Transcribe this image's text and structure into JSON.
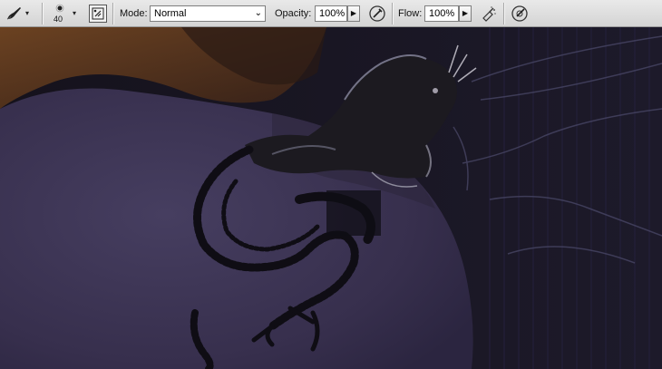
{
  "toolbar": {
    "brush_size": "40",
    "mode_label": "Mode:",
    "mode_value": "Normal",
    "opacity_label": "Opacity:",
    "opacity_value": "100%",
    "flow_label": "Flow:",
    "flow_value": "100%",
    "arrow_glyph": "▶",
    "dropdown_glyph": "▾"
  },
  "icons": {
    "brush_tool": "brush-icon",
    "brush_preset": "brush-preset-icon",
    "brush_panel": "brush-panel-toggle-icon",
    "opacity_pressure": "tablet-pressure-opacity-icon",
    "airbrush": "airbrush-icon",
    "size_pressure": "tablet-pressure-size-icon"
  },
  "colors": {
    "toolbar_bg": "#d9d9d9",
    "canvas_skin": "#3b3452",
    "canvas_bg_dark": "#17141f",
    "hair": "#6a3a1c",
    "tattoo": "#0e0c12"
  }
}
